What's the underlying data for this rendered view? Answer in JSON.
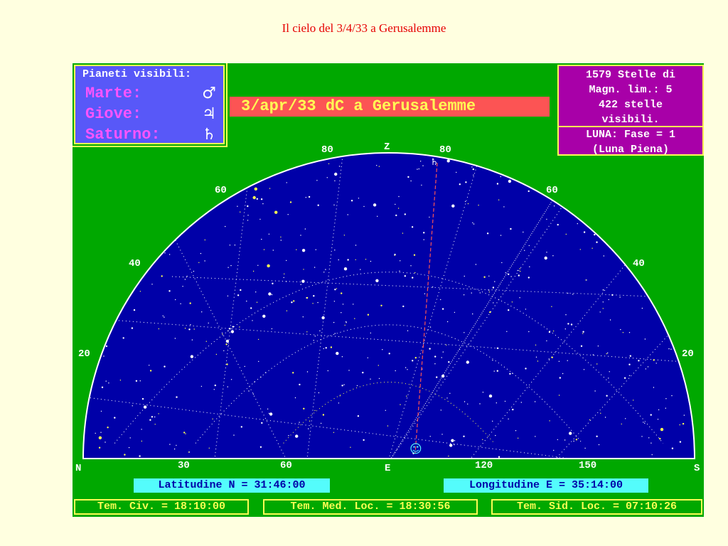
{
  "title": "Il cielo del 3/4/33 a Gerusalemme",
  "planets_panel": {
    "header": "Pianeti visibili:",
    "items": [
      {
        "name": "Marte:",
        "symbol": "♂"
      },
      {
        "name": "Giove:",
        "symbol": "♃"
      },
      {
        "name": "Saturno:",
        "symbol": "♄"
      }
    ]
  },
  "banner": "3/apr/33 dC a Gerusalemme",
  "info_panel": {
    "stars_line1": "1579 Stelle di",
    "stars_line2": "Magn. lim.: 5",
    "stars_line3": "422 stelle",
    "stars_line4": "visibili.",
    "moon_line1": "LUNA: Fase = 1",
    "moon_line2": "(Luna Piena)"
  },
  "sky": {
    "zenith_label": "Z",
    "altitude_labels": [
      "80",
      "80",
      "60",
      "60",
      "40",
      "40",
      "20",
      "20"
    ],
    "saturn_marker": "♄",
    "moon_marker": "☺"
  },
  "horizon": {
    "north": "N",
    "east": "E",
    "south": "S",
    "azimuth_labels": [
      "30",
      "60",
      "120",
      "150"
    ]
  },
  "latitude": "Latitudine N = 31:46:00",
  "longitude": "Longitudine E = 35:14:00",
  "times": {
    "civil": "Tem. Civ. = 18:10:00",
    "mean_local": "Tem. Med. Loc. = 18:30:56",
    "sidereal_local": "Tem. Sid. Loc. = 07:10:26"
  },
  "colors": {
    "page_bg": "#ffffe0",
    "title": "#e60000",
    "screen_bg": "#00a800",
    "sky_blue": "#0000a8",
    "planet_panel": "#5858f8",
    "info_panel": "#a800a8",
    "banner_bg": "#fc5454",
    "cyan_bar": "#54fcfc",
    "yellow": "#fcfc54"
  }
}
